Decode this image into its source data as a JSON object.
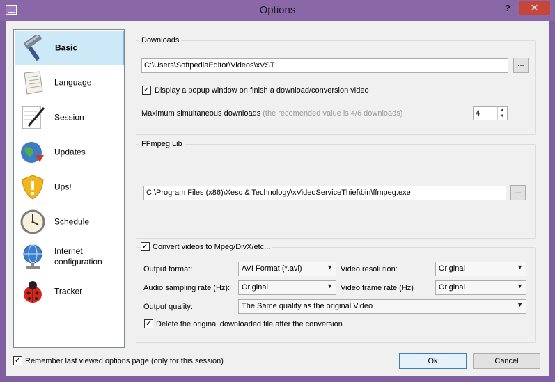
{
  "window": {
    "title": "Options",
    "help_label": "?",
    "close_label": "✕"
  },
  "sidebar": {
    "items": [
      {
        "label": "Basic",
        "icon": "hammer-icon",
        "selected": true
      },
      {
        "label": "Language",
        "icon": "scroll-icon",
        "selected": false
      },
      {
        "label": "Session",
        "icon": "notepad-pen-icon",
        "selected": false
      },
      {
        "label": "Updates",
        "icon": "globe-update-icon",
        "selected": false
      },
      {
        "label": "Ups!",
        "icon": "shield-warning-icon",
        "selected": false
      },
      {
        "label": "Schedule",
        "icon": "clock-icon",
        "selected": false
      },
      {
        "label": "Internet configuration",
        "icon": "internet-globe-icon",
        "selected": false
      },
      {
        "label": "Tracker",
        "icon": "ladybug-icon",
        "selected": false
      }
    ]
  },
  "downloads": {
    "group_title": "Downloads",
    "path_value": "C:\\Users\\SoftpediaEditor\\Videos\\xVST",
    "browse_label": "...",
    "popup_checked": true,
    "popup_label": "Display a popup window on finish a download/conversion video",
    "max_label": "Maximum simultaneous downloads",
    "max_hint": "(the recomended value is 4/6 downloads)",
    "max_value": "4"
  },
  "ffmpeg": {
    "group_title": "FFmpeg Lib",
    "path_value": "C:\\Program Files (x86)\\Xesc & Technology\\xVideoServiceThief\\bin\\ffmpeg.exe",
    "browse_label": "..."
  },
  "convert": {
    "checked": true,
    "group_title": "Convert videos to Mpeg/DivX/etc...",
    "output_format_label": "Output format:",
    "output_format_value": "AVI Format (*.avi)",
    "video_resolution_label": "Video resolution:",
    "video_resolution_value": "Original",
    "audio_sampling_label": "Audio sampling rate (Hz):",
    "audio_sampling_value": "Original",
    "video_frame_rate_label": "Video frame rate (Hz)",
    "video_frame_rate_value": "Original",
    "output_quality_label": "Output quality:",
    "output_quality_value": "The Same quality as the original Video",
    "delete_checked": true,
    "delete_label": "Delete the original downloaded file after the conversion"
  },
  "footer": {
    "remember_checked": true,
    "remember_label": "Remember last viewed options page (only for this session)",
    "ok_label": "Ok",
    "cancel_label": "Cancel"
  },
  "colors": {
    "titlebar": "#8a68a8",
    "close_button": "#c7463c",
    "selection": "#cde8f7"
  }
}
